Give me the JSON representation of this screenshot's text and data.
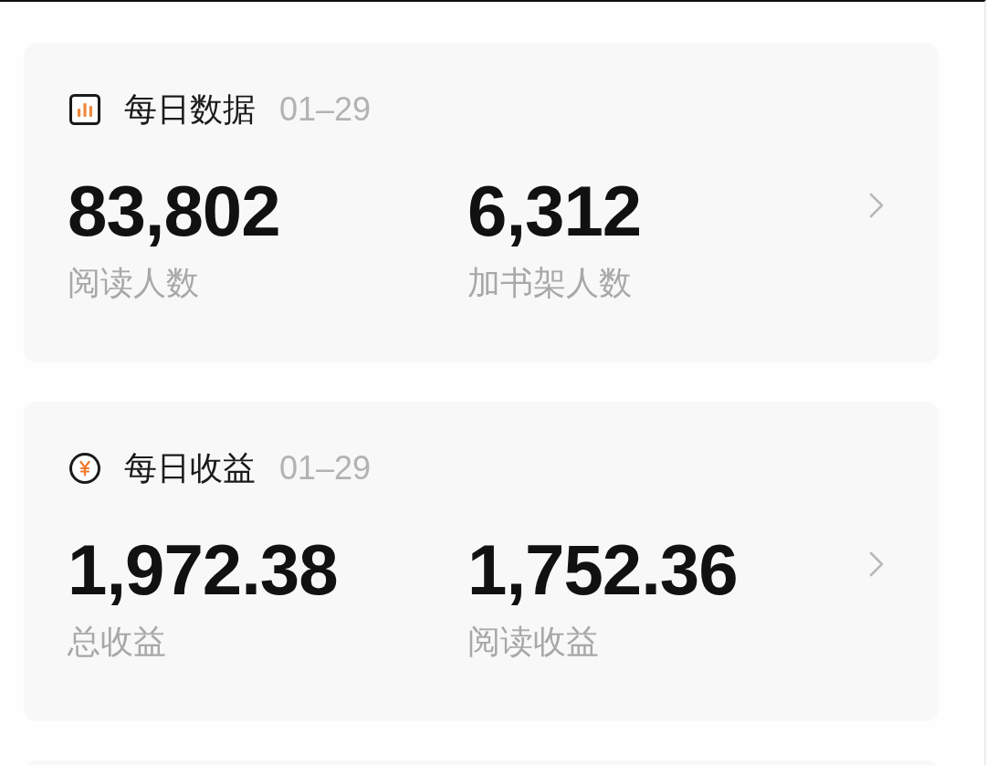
{
  "cards": [
    {
      "kind": "chart",
      "title": "每日数据",
      "date": "01–29",
      "metrics": [
        {
          "value": "83,802",
          "label": "阅读人数"
        },
        {
          "value": "6,312",
          "label": "加书架人数"
        }
      ]
    },
    {
      "kind": "income",
      "title": "每日收益",
      "date": "01–29",
      "metrics": [
        {
          "value": "1,972.38",
          "label": "总收益"
        },
        {
          "value": "1,752.36",
          "label": "阅读收益"
        }
      ]
    }
  ]
}
